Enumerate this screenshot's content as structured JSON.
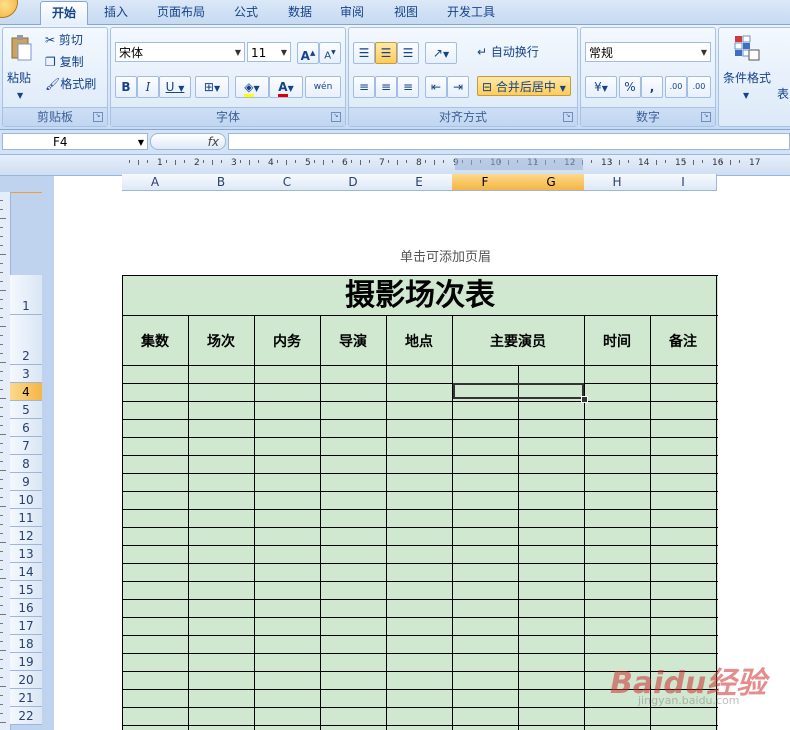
{
  "tabs": [
    "开始",
    "插入",
    "页面布局",
    "公式",
    "数据",
    "审阅",
    "视图",
    "开发工具"
  ],
  "clipboard": {
    "paste": "粘贴",
    "cut": "剪切",
    "copy": "复制",
    "format_painter": "格式刷",
    "label": "剪贴板"
  },
  "font": {
    "name": "宋体",
    "size": "11",
    "bold": "B",
    "italic": "I",
    "underline": "U",
    "color_a": "A",
    "grow": "A",
    "shrink": "A",
    "label": "字体",
    "phonetic": "wén"
  },
  "alignment": {
    "wrap": "自动换行",
    "merge": "合并后居中",
    "label": "对齐方式"
  },
  "number": {
    "format": "常规",
    "percent": "%",
    "comma": ",",
    "inc_dec": ".00",
    "label": "数字"
  },
  "styles": {
    "conditional": "条件格式",
    "table": "表"
  },
  "formula_bar": {
    "name_box": "F4",
    "fx": "fx",
    "value": ""
  },
  "ruler_numbers": [
    "1",
    "2",
    "3",
    "4",
    "5",
    "6",
    "7",
    "8",
    "9",
    "10",
    "11",
    "12",
    "13",
    "14",
    "15",
    "16",
    "17"
  ],
  "columns": [
    "A",
    "B",
    "C",
    "D",
    "E",
    "F",
    "G",
    "H",
    "I"
  ],
  "rows": [
    "1",
    "2",
    "3",
    "4",
    "5",
    "6",
    "7",
    "8",
    "9",
    "10",
    "11",
    "12",
    "13",
    "14",
    "15",
    "16",
    "17",
    "18",
    "19",
    "20",
    "21",
    "22"
  ],
  "header_placeholder": "单击可添加页眉",
  "sheet": {
    "title": "摄影场次表",
    "headers": [
      "集数",
      "场次",
      "内务",
      "导演",
      "地点",
      "主要演员",
      "时间",
      "备注"
    ],
    "selected_cell": "F4"
  },
  "watermark": {
    "brand": "Baidu经验",
    "url": "jingyan.baidu.com"
  },
  "colors": {
    "table_fill": "#cfe8cf",
    "selected_header": "#f6b545",
    "ribbon": "#d7e6f8"
  }
}
